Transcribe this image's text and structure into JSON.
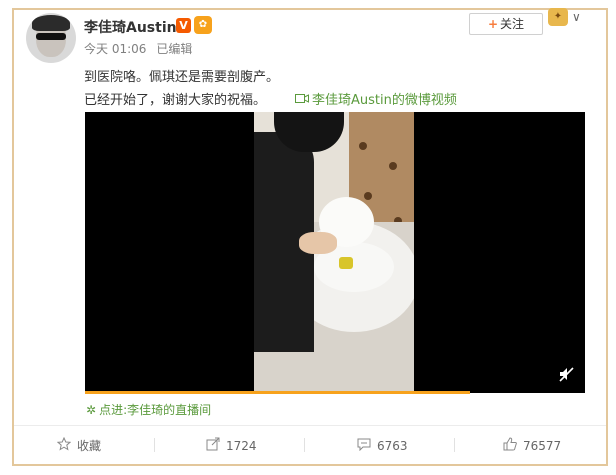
{
  "post": {
    "username": "李佳琦Austin",
    "verified_badge": "V",
    "vip_badge": "✿",
    "time": "今天 01:06",
    "edited": "已编辑",
    "line1": "到医院咯。佩琪还是需要剖腹产。",
    "line2": "已经开始了，谢谢大家的祝福。",
    "video_link": "李佳琦Austin的微博视频",
    "live_link": "点进:李佳琦的直播间",
    "progress_fraction": 0.77
  },
  "header": {
    "follow_label": "关注",
    "follow_plus": "+",
    "chevron": "∨"
  },
  "actions": [
    {
      "label": "收藏",
      "icon": "star-icon"
    },
    {
      "label": "1724",
      "icon": "share-icon"
    },
    {
      "label": "6763",
      "icon": "comment-icon"
    },
    {
      "label": "76577",
      "icon": "like-icon"
    }
  ],
  "colors": {
    "frame": "#e3c79b",
    "accent_orange": "#f7a21c",
    "link_green": "#5a9a3c",
    "verified_orange": "#f55a00"
  }
}
